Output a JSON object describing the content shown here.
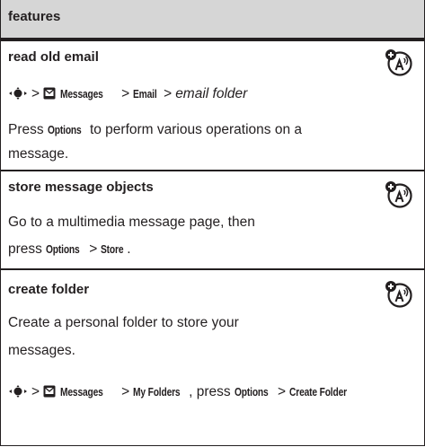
{
  "header": {
    "title": "features"
  },
  "sections": [
    {
      "title": "read old email",
      "path": {
        "messages": "Messages",
        "email": "Email",
        "folder": "email folder"
      },
      "body": {
        "press": "Press",
        "options": "Options",
        "line1_rest": "to perform various operations on a",
        "line2": "message."
      }
    },
    {
      "title": "store message objects",
      "line1": "Go to a multimedia message page, then",
      "line2": {
        "press": "press",
        "options": "Options",
        "store": "Store",
        "period": "."
      }
    },
    {
      "title": "create folder",
      "line1": "Create a personal folder to store your",
      "line2": "messages.",
      "path": {
        "messages": "Messages",
        "myfolders": "My Folders",
        "press": ", press",
        "options": "Options",
        "create": "Create Folder"
      }
    }
  ],
  "symbols": {
    "gt": ">"
  },
  "icons": {
    "nav": "nav-key-icon",
    "messages": "messages-icon",
    "feature": "network-feature-icon"
  }
}
